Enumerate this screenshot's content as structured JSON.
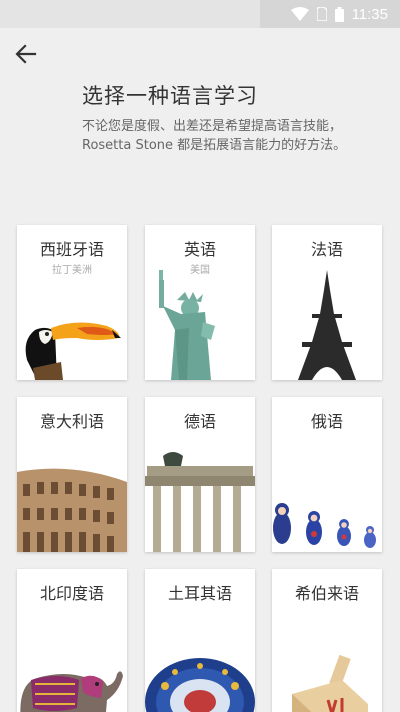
{
  "status_bar": {
    "time": "11:35",
    "icons": [
      "wifi-icon",
      "sim-icon",
      "battery-icon"
    ]
  },
  "header": {
    "back_icon": "arrow-left-icon",
    "title": "选择一种语言学习",
    "subtitle": "不论您是度假、出差还是希望提高语言技能，Rosetta Stone 都是拓展语言能力的好方法。"
  },
  "languages": [
    {
      "name": "西班牙语",
      "sub": "拉丁美洲",
      "image": "toucan"
    },
    {
      "name": "英语",
      "sub": "美国",
      "image": "statue-of-liberty"
    },
    {
      "name": "法语",
      "sub": "",
      "image": "eiffel-tower"
    },
    {
      "name": "意大利语",
      "sub": "",
      "image": "colosseum"
    },
    {
      "name": "德语",
      "sub": "",
      "image": "brandenburg-gate"
    },
    {
      "name": "俄语",
      "sub": "",
      "image": "matryoshka-dolls"
    },
    {
      "name": "北印度语",
      "sub": "",
      "image": "elephant"
    },
    {
      "name": "土耳其语",
      "sub": "",
      "image": "ceramic-plate"
    },
    {
      "name": "希伯来语",
      "sub": "",
      "image": "dreidel"
    }
  ],
  "colors": {
    "background": "#efefef",
    "card": "#ffffff",
    "title_text": "#333333",
    "subtitle_text": "#666666"
  }
}
